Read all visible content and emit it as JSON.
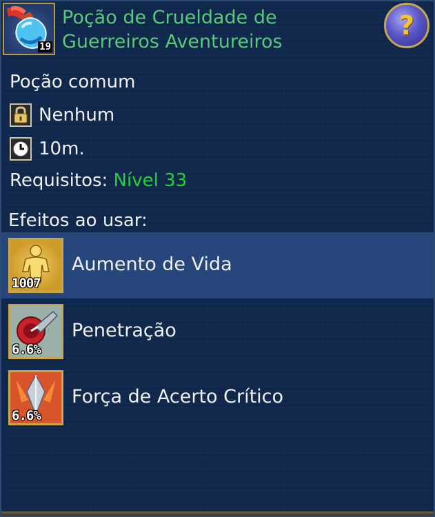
{
  "item": {
    "name": "Poção de Crueldade de Guerreiros Aventureiros",
    "icon": "potion-icon",
    "count": "19",
    "type": "Poção comum"
  },
  "help": {
    "label": "?",
    "icon": "question-mark-icon"
  },
  "binding": {
    "icon": "lock-icon",
    "value": "Nenhum"
  },
  "duration": {
    "icon": "clock-icon",
    "value": "10m."
  },
  "requirements": {
    "label": "Requisitos:",
    "value": "Nível 33"
  },
  "effects_heading": "Efeitos ao usar:",
  "effects": [
    {
      "name": "Aumento de Vida",
      "value": "1007",
      "icon": "vitality-figure-icon",
      "selected": true
    },
    {
      "name": "Penetração",
      "value": "6.6%",
      "icon": "penetration-icon",
      "selected": false
    },
    {
      "name": "Força de Acerto Crítico",
      "value": "6.6%",
      "icon": "crystal-critical-icon",
      "selected": false
    }
  ],
  "colors": {
    "title": "#58c879",
    "requirement_value": "#22d43a",
    "background": "#11284d",
    "selected_row": "#27467c",
    "frame_gold": "#c9a64a"
  }
}
